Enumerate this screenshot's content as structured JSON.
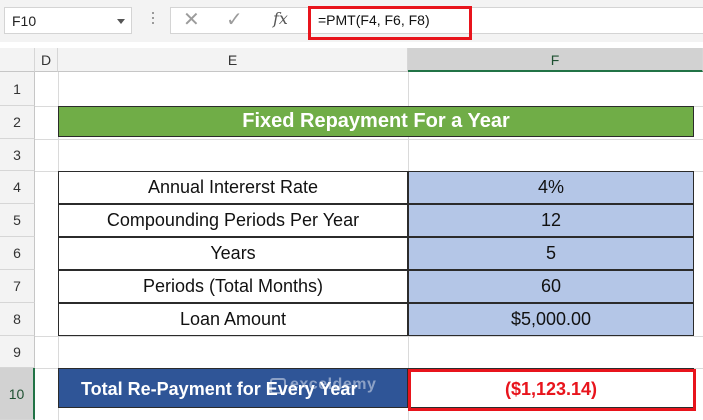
{
  "formula_bar": {
    "name_box": "F10",
    "cancel_icon": "x-icon",
    "enter_icon": "check-icon",
    "fx_label": "fx",
    "formula": "=PMT(F4, F6, F8)"
  },
  "columns": [
    "D",
    "E",
    "F"
  ],
  "selected_column": "F",
  "rows": [
    "1",
    "2",
    "3",
    "4",
    "5",
    "6",
    "7",
    "8",
    "9",
    "10"
  ],
  "selected_row": "10",
  "sheet": {
    "title": "Fixed Repayment For a Year",
    "table": [
      {
        "label": "Annual Intererst Rate",
        "value": "4%"
      },
      {
        "label": "Compounding Periods Per Year",
        "value": "12"
      },
      {
        "label": "Years",
        "value": "5"
      },
      {
        "label": "Periods (Total Months)",
        "value": "60"
      },
      {
        "label": "Loan Amount",
        "value": "$5,000.00"
      }
    ],
    "result_label": "Total Re-Payment for Every Year",
    "result_value": "($1,123.14)"
  },
  "watermark": "exceldemy",
  "colors": {
    "title_bg": "#70ad47",
    "value_bg": "#b4c6e7",
    "result_bg": "#2f5597",
    "highlight": "#e8141c"
  }
}
